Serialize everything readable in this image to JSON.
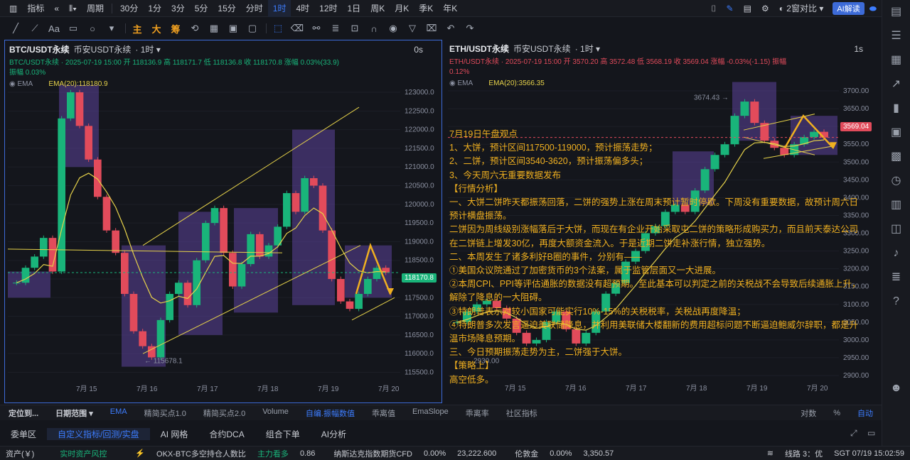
{
  "topbar": {
    "indicator_label": "指标",
    "period_label": "周期",
    "intervals": [
      "30分",
      "1分",
      "3分",
      "5分",
      "15分",
      "分时",
      "1时",
      "4时",
      "12时",
      "1日",
      "周K",
      "月K",
      "季K",
      "年K"
    ],
    "active_interval": "1时",
    "compare_label": "2窗对比",
    "ai_label": "AI解读"
  },
  "drawbar": {
    "text_tool": "Aa",
    "orange_tools": [
      "主",
      "大",
      "筹"
    ]
  },
  "panelA": {
    "symbol": "BTC/USDT永续",
    "exchange": "币安USDT永续",
    "timeframe": "1时",
    "countdown": "0s",
    "ohlc_line1": "BTC/USDT永续 · 2025-07-19 15:00 开 118136.9 高 118171.7 低 118136.8 收 118170.8 涨幅 0.03%(33.9)",
    "ohlc_line2": "振幅 0.03%",
    "ema_name": "EMA",
    "ema_value": "EMA(20):118180.9",
    "low_label": "← 115678.1",
    "current_price": "118170.8",
    "y_ticks": [
      "123000.0",
      "122500.0",
      "122000.0",
      "121500.0",
      "121000.0",
      "120500.0",
      "120000.0",
      "119500.0",
      "119000.0",
      "118500.0",
      "118000.0",
      "117500.0",
      "117000.0",
      "116500.0",
      "116000.0",
      "115500.0"
    ],
    "x_ticks": [
      "7月 15",
      "7月 16",
      "7月 17",
      "7月 18",
      "7月 19",
      "7月 20"
    ]
  },
  "panelB": {
    "symbol": "ETH/USDT永续",
    "exchange": "币安USDT永续",
    "timeframe": "1时",
    "countdown": "1s",
    "ohlc_line1": "ETH/USDT永续 · 2025-07-19 15:00 开 3570.20 高 3572.48 低 3568.19 收 3569.04 涨幅 -0.03%(-1.15) 振幅",
    "ohlc_line2": "0.12%",
    "ema_name": "EMA",
    "ema_value": "EMA(20):3566.35",
    "high_label": "3674.43 →",
    "low_label": "2930.00",
    "current_price": "3569.04",
    "y_ticks": [
      "3700.00",
      "3650.00",
      "3600.00",
      "3550.00",
      "3500.00",
      "3450.00",
      "3400.00",
      "3350.00",
      "3300.00",
      "3250.00",
      "3200.00",
      "3150.00",
      "3100.00",
      "3050.00",
      "3000.00",
      "2950.00",
      "2900.00"
    ],
    "x_ticks": [
      "7月 15",
      "7月 16",
      "7月 17",
      "7月 18",
      "7月 19",
      "7月 20"
    ]
  },
  "note": {
    "text": "7月19日午盘观点\n1、大饼，预计区间117500-119000，预计振荡走势；\n2、二饼，预计区间3540-3620，预计振荡偏多头；\n3、今天周六无重要数据发布\n【行情分析】\n一、大饼二饼昨天都振荡回落，二饼的强势上涨在周末预计暂时停歇。下周没有重要数据，故预计周六日\n预计横盘振荡。\n二饼因为周线级别涨幅落后于大饼，而现在有企业开始采取屯二饼的策略形成购买力，而且前天泰达公司\n在二饼链上增发30亿，再度大额资金流入。于是近期二饼走补涨行情，独立强势。\n二、本周发生了诸多利好B圈的事件，分别有——\n①美国众议院通过了加密货币的3个法案，属于监管层面又一大进展。\n②本周CPI、PPI等评估通胀的数据没有超预期。至此基本可以判定之前的关税战不会导致后续通胀上升，\n解除了降息的一大阻碍。\n③特朗普表示对较小国家可能实行10%-15%的关税税率，关税战再度降温；\n④特朗普多次发言逼迫美联储降息，并利用美联储大楼翻新的费用超标问题不断逼迫鲍威尔辞职，都是升\n温市场降息预期。\n三、今日预期振荡走势为主，二饼强于大饼。\n【策略上】\n高空低多。"
  },
  "tabsbar": {
    "position": "定位到...",
    "date_range": "日期范围",
    "tabs": [
      "EMA",
      "精简买点1.0",
      "精简买点2.0",
      "Volume",
      "自编.振幅数值",
      "乖离值",
      "EmaSlope",
      "乖离率",
      "社区指标"
    ],
    "scale": [
      "对数",
      "%",
      "自动"
    ]
  },
  "bottomtabs": [
    "委单区",
    "自定义指标/回测/实盘",
    "AI 网格",
    "合约DCA",
    "组合下单",
    "AI分析"
  ],
  "status": {
    "asset": "资产(￥)",
    "risk": "实时资产风控",
    "ratio_label": "OKX-BTC多空持仓人数比",
    "ratio_tag": "主力看多",
    "ratio_value": "0.86",
    "nasdaq_label": "纳斯达克指数期货CFD",
    "nasdaq_pct": "0.00%",
    "nasdaq_value": "23,222.600",
    "gold_label": "伦敦金",
    "gold_pct": "0.00%",
    "gold_value": "3,350.57",
    "line": "线路 3：优",
    "time": "SGT 07/19 15:02:59"
  },
  "colors": {
    "accent": "#3d7dff",
    "up": "#19b47a",
    "down": "#e24b5b",
    "ema": "#e6d24a",
    "annotation": "#f0b020",
    "box": "#7a55c8"
  },
  "chart_data": [
    {
      "type": "candlestick",
      "title": "BTC/USDT永续",
      "ylim": [
        115300,
        123400
      ],
      "x": [
        "7月 15",
        "7月 16",
        "7月 17",
        "7月 18",
        "7月 19",
        "7月 20"
      ],
      "close": [
        117900,
        118300,
        118600,
        119100,
        118200,
        122300,
        123000,
        122100,
        121200,
        120200,
        119300,
        118700,
        117600,
        116600,
        116200,
        115900,
        116900,
        117600,
        117900,
        117300,
        118500,
        119500,
        119900,
        118700,
        117800,
        118400,
        119200,
        118600,
        118900,
        119400,
        120300,
        119800,
        120700,
        120500,
        119300,
        118000,
        117400,
        117200,
        117600,
        118000,
        118300,
        118170
      ]
    },
    {
      "type": "candlestick",
      "title": "ETH/USDT永续",
      "ylim": [
        2890,
        3740
      ],
      "x": [
        "7月 15",
        "7月 16",
        "7月 17",
        "7月 18",
        "7月 19",
        "7月 20"
      ],
      "close": [
        3050,
        3080,
        3100,
        3110,
        3090,
        3060,
        3020,
        2990,
        3000,
        3050,
        3080,
        3030,
        2990,
        3020,
        3080,
        3130,
        3160,
        3220,
        3250,
        3300,
        3320,
        3360,
        3380,
        3360,
        3420,
        3480,
        3520,
        3550,
        3630,
        3670,
        3610,
        3560,
        3540,
        3520,
        3550,
        3570,
        3585,
        3569
      ]
    }
  ]
}
